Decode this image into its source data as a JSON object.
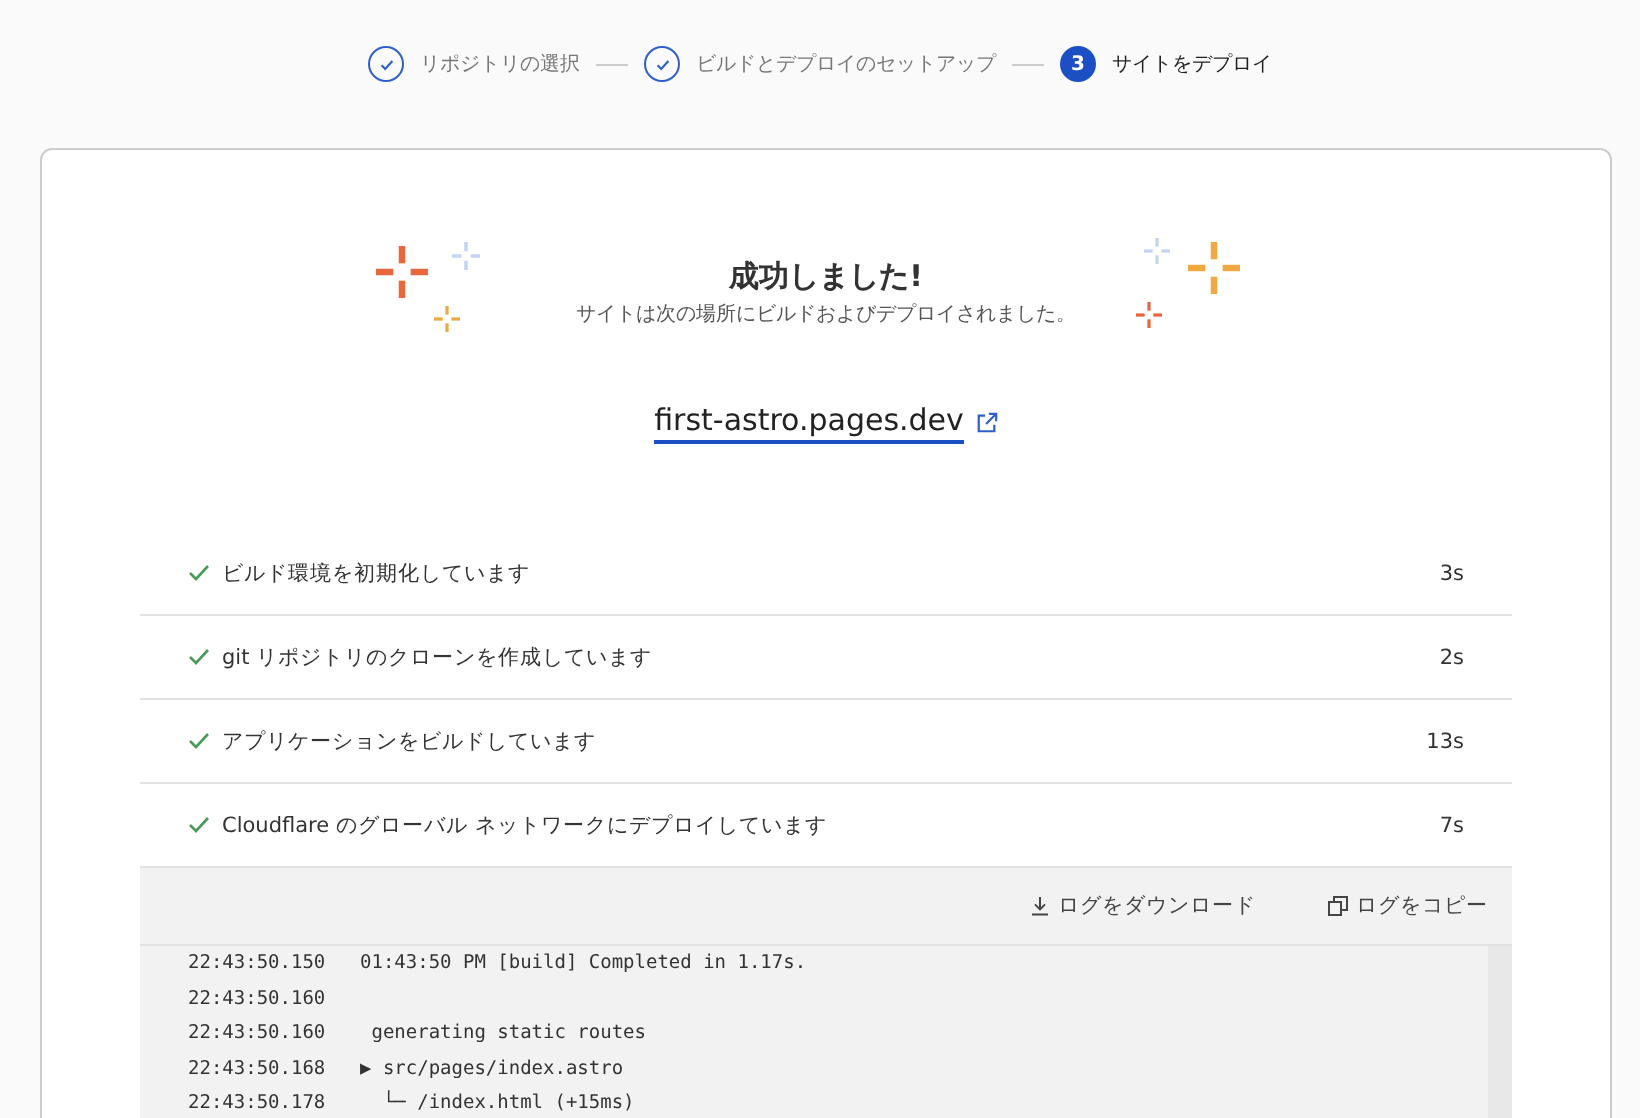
{
  "stepper": [
    {
      "completed": true,
      "label": "リポジトリの選択"
    },
    {
      "completed": true,
      "label": "ビルドとデプロイのセットアップ"
    },
    {
      "completed": false,
      "number": "3",
      "label": "サイトをデプロイ"
    }
  ],
  "success": {
    "title": "成功しました!",
    "subtitle": "サイトは次の場所にビルドおよびデプロイされました。",
    "link": "first-astro.pages.dev"
  },
  "build_steps": [
    {
      "done": true,
      "label": "ビルド環境を初期化しています",
      "duration": "3s"
    },
    {
      "done": true,
      "label": "git リポジトリのクローンを作成しています",
      "duration": "2s"
    },
    {
      "done": true,
      "label": "アプリケーションをビルドしています",
      "duration": "13s"
    },
    {
      "done": true,
      "label": "Cloudflare のグローバル ネットワークにデプロイしています",
      "duration": "7s"
    }
  ],
  "log_toolbar": {
    "download": "ログをダウンロード",
    "copy": "ログをコピー"
  },
  "log_lines": [
    {
      "time": "22:43:50.150",
      "message": "01:43:50 PM [build] Completed in 1.17s."
    },
    {
      "time": "22:43:50.160"
    },
    {
      "time": "22:43:50.160",
      "message": " generating static routes"
    },
    {
      "time": "22:43:50.168",
      "message": "▶ src/pages/index.astro"
    },
    {
      "time": "22:43:50.178",
      "message": "  └─ /index.html (+15ms)"
    }
  ]
}
